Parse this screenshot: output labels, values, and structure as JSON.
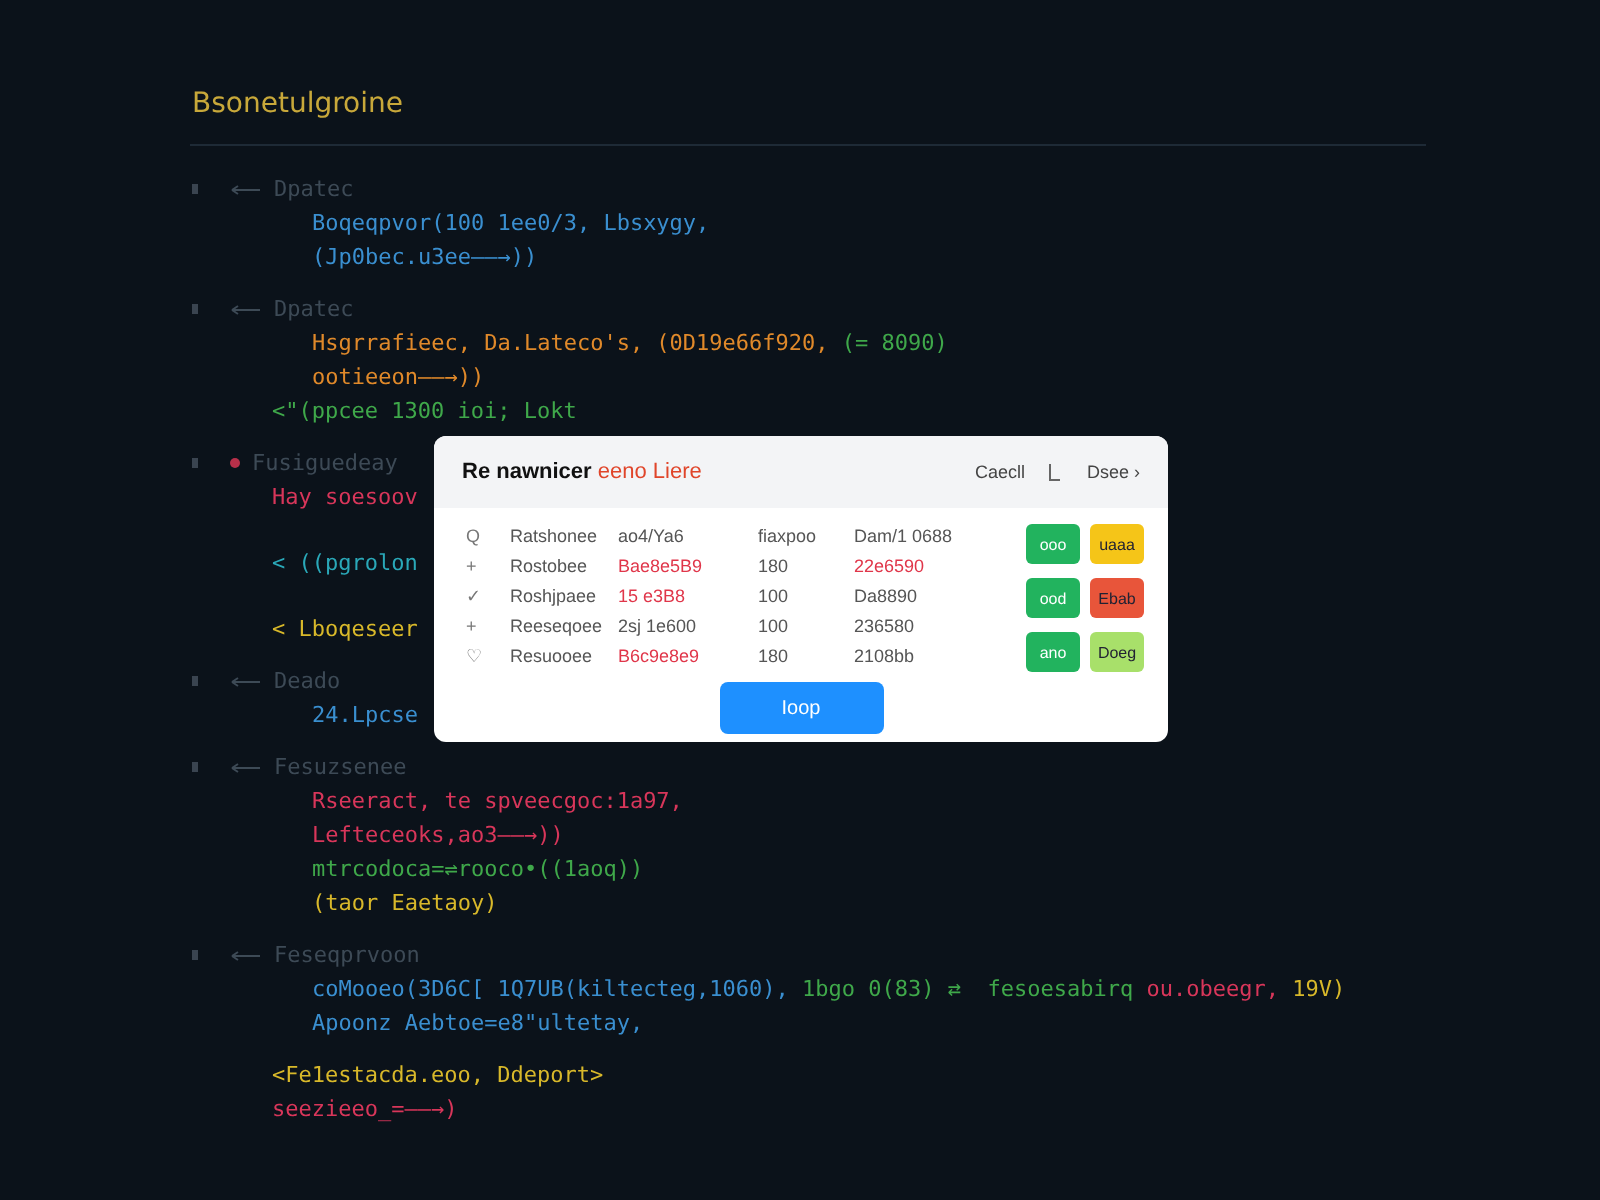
{
  "title": "Bsonetulgroine",
  "blocks": [
    {
      "kind": "arrow",
      "label": "Dpatec",
      "lines": [
        {
          "kind": "code",
          "segments": [
            {
              "text": "Boqeqpvor(100 1ee0/3, Lbsxygy,",
              "color": "#3a8fd0"
            }
          ]
        },
        {
          "kind": "code",
          "segments": [
            {
              "text": "(Jp0bec.u3ee——→))",
              "color": "#3a8fd0"
            }
          ]
        }
      ]
    },
    {
      "kind": "arrow",
      "label": "Dpatec",
      "lines": [
        {
          "kind": "code",
          "segments": [
            {
              "text": "Hsgrrafieec, Da.Lateco's, (0D19e66f920, ",
              "color": "#e0892a"
            },
            {
              "text": "(= 8090)",
              "color": "#3fa84a"
            }
          ]
        },
        {
          "kind": "code",
          "segments": [
            {
              "text": "ootieeon——→))",
              "color": "#e0892a"
            }
          ]
        },
        {
          "kind": "tag",
          "segments": [
            {
              "text": "<\"(ppcee 1300 ioi; Lokt",
              "color": "#3fa84a"
            }
          ]
        }
      ]
    },
    {
      "kind": "dot",
      "label": "Fusiguedeay",
      "lines": [
        {
          "kind": "tag",
          "segments": [
            {
              "text": "Hay soesoov",
              "color": "#d8365a"
            }
          ]
        },
        {
          "kind": "tag",
          "segments": [
            {
              "text": "< ((pgrolon",
              "color": "#2aa8b8"
            }
          ]
        },
        {
          "kind": "tag",
          "segments": [
            {
              "text": "< Lboqeseer",
              "color": "#d8b82a"
            }
          ]
        }
      ]
    },
    {
      "kind": "arrow",
      "label": "Deado",
      "lines": [
        {
          "kind": "code",
          "segments": [
            {
              "text": "24.Lpcse",
              "color": "#3a8fd0"
            }
          ]
        }
      ]
    },
    {
      "kind": "arrow",
      "label": "Fesuzsenee",
      "lines": [
        {
          "kind": "code",
          "segments": [
            {
              "text": "Rseeract, te spveecgoc:1a97,",
              "color": "#d8365a"
            }
          ]
        },
        {
          "kind": "code",
          "segments": [
            {
              "text": "Lefteceoks,ao3——→))",
              "color": "#d8365a"
            }
          ]
        },
        {
          "kind": "code",
          "segments": [
            {
              "text": "mtrcodoca=⇌rooco•((1aoq))",
              "color": "#3fa84a"
            }
          ]
        },
        {
          "kind": "code",
          "segments": [
            {
              "text": "(taor Eaetaoy)",
              "color": "#d8b82a"
            }
          ]
        }
      ]
    },
    {
      "kind": "arrow",
      "label": "Feseqprvoon",
      "lines": [
        {
          "kind": "code",
          "segments": [
            {
              "text": "coMooeo(3D6C[ 1Q7UB(kiltecteg,1060), ",
              "color": "#3a8fd0"
            },
            {
              "text": "1bgo 0(83) ⇄  fesoesabirq ",
              "color": "#3fa84a"
            },
            {
              "text": "ou.obeegr, ",
              "color": "#d8365a"
            },
            {
              "text": "19V)",
              "color": "#d8b82a"
            }
          ]
        },
        {
          "kind": "code",
          "segments": [
            {
              "text": "Apoonz Aebtoe=e8\"ultetay,",
              "color": "#3a8fd0"
            }
          ]
        }
      ]
    }
  ],
  "footer": [
    {
      "kind": "tag",
      "segments": [
        {
          "text": "<Fe1estacda.eoo, Ddeport>",
          "color": "#d8b82a"
        }
      ]
    },
    {
      "kind": "tag",
      "segments": [
        {
          "text": "seezieeo_=——→)",
          "color": "#d8365a"
        }
      ]
    }
  ],
  "dialog": {
    "title": [
      {
        "text": "Re nawnicer ",
        "color": "#111111"
      },
      {
        "text": "eeno Liere",
        "color": "#e0452a"
      }
    ],
    "cancel": "Caecll",
    "close": "Dsee ›",
    "rows": [
      {
        "mark": "Q",
        "name": "Ratshonee",
        "values": [
          {
            "text": "ao4/Ya6",
            "color": "#555555"
          },
          {
            "text": "fiaxpoo",
            "color": "#555555"
          },
          {
            "text": "Dam/1 0688",
            "color": "#555555"
          }
        ]
      },
      {
        "mark": "+",
        "name": "Rostobee",
        "values": [
          {
            "text": "Bae8e5B9",
            "color": "#e0364a"
          },
          {
            "text": "180",
            "color": "#555555"
          },
          {
            "text": "22e6590",
            "color": "#e0364a"
          }
        ]
      },
      {
        "mark": "✓",
        "name": "Roshjpaee",
        "values": [
          {
            "text": "15 e3B8",
            "color": "#e0364a"
          },
          {
            "text": "100",
            "color": "#555555"
          },
          {
            "text": "Da8890",
            "color": "#555555"
          }
        ]
      },
      {
        "mark": "+",
        "name": "Reeseqoee",
        "values": [
          {
            "text": "2sj 1e600",
            "color": "#555555"
          },
          {
            "text": "100",
            "color": "#555555"
          },
          {
            "text": "236580",
            "color": "#555555"
          }
        ]
      },
      {
        "mark": "♡",
        "name": "Resuooee",
        "values": [
          {
            "text": "B6c9e8e9",
            "color": "#e0364a"
          },
          {
            "text": "180",
            "color": "#555555"
          },
          {
            "text": "2108bb",
            "color": "#555555"
          }
        ]
      }
    ],
    "actions": [
      [
        {
          "label": "ooo",
          "color": "#22b35e"
        },
        {
          "label": "uaaa",
          "color": "#f5c518"
        }
      ],
      [
        {
          "label": "ood",
          "color": "#22b35e"
        },
        {
          "label": "Ebab",
          "color": "#e8553a"
        }
      ],
      [
        {
          "label": "ano",
          "color": "#22b35e"
        },
        {
          "label": "Doeg",
          "color": "#a8e06a"
        }
      ]
    ],
    "primary": "Ioop"
  }
}
